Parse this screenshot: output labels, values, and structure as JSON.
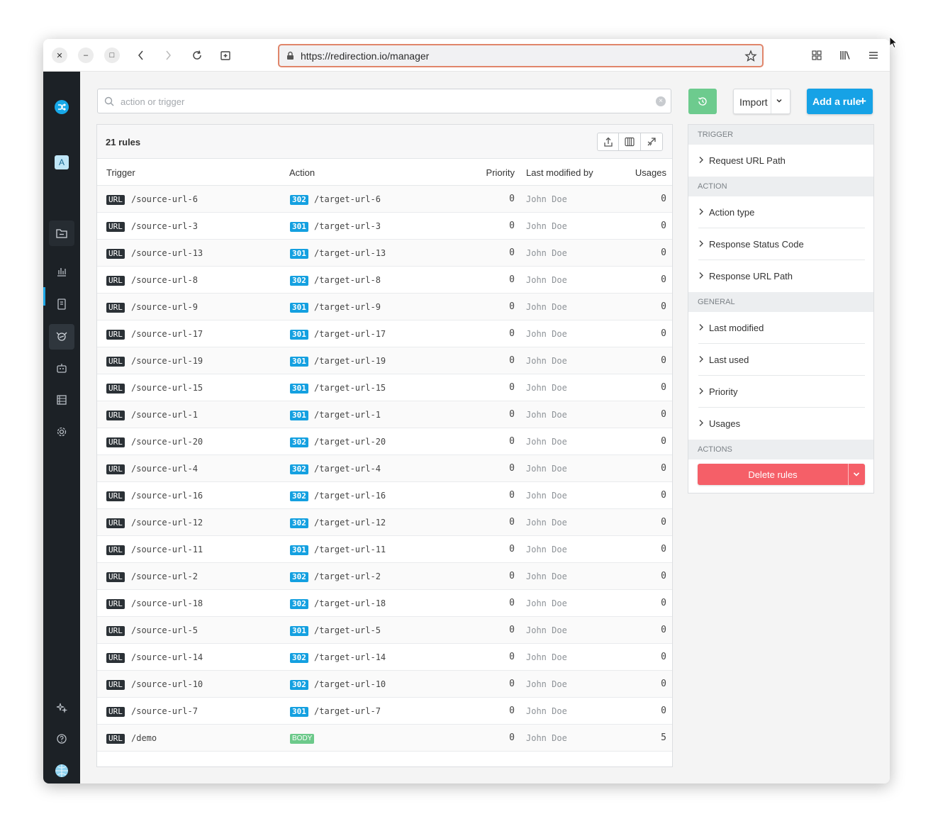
{
  "browser": {
    "url": "https://redirection.io/manager",
    "window_buttons": [
      "close",
      "minimize",
      "maximize"
    ]
  },
  "colors": {
    "accent": "#16a2e6",
    "success": "#6dcb8e",
    "danger": "#f55f68",
    "sidebar": "#1c2126"
  },
  "sidebar": {
    "avatar_letter": "A",
    "icons": [
      "redirection-logo-icon",
      "project-icon",
      "folder-icon",
      "analytics-icon",
      "logs-icon",
      "rules-icon",
      "robot-icon",
      "instances-icon",
      "settings-icon",
      "sparkles-icon",
      "help-icon",
      "globe-icon",
      "expand-icon"
    ]
  },
  "search": {
    "placeholder": "action or trigger"
  },
  "toolbar": {
    "import_label": "Import",
    "add_rule_label": "Add a rule",
    "add_rule_plus": "+"
  },
  "table": {
    "count_label": "21 rules",
    "columns": {
      "trigger": "Trigger",
      "action": "Action",
      "priority": "Priority",
      "last_modified_by": "Last modified by",
      "usages": "Usages"
    },
    "rows": [
      {
        "type": "URL",
        "source": "/source-url-6",
        "code": "302",
        "target": "/target-url-6",
        "priority": "0",
        "by": "John Doe",
        "usages": "0"
      },
      {
        "type": "URL",
        "source": "/source-url-3",
        "code": "301",
        "target": "/target-url-3",
        "priority": "0",
        "by": "John Doe",
        "usages": "0"
      },
      {
        "type": "URL",
        "source": "/source-url-13",
        "code": "301",
        "target": "/target-url-13",
        "priority": "0",
        "by": "John Doe",
        "usages": "0"
      },
      {
        "type": "URL",
        "source": "/source-url-8",
        "code": "302",
        "target": "/target-url-8",
        "priority": "0",
        "by": "John Doe",
        "usages": "0"
      },
      {
        "type": "URL",
        "source": "/source-url-9",
        "code": "301",
        "target": "/target-url-9",
        "priority": "0",
        "by": "John Doe",
        "usages": "0"
      },
      {
        "type": "URL",
        "source": "/source-url-17",
        "code": "301",
        "target": "/target-url-17",
        "priority": "0",
        "by": "John Doe",
        "usages": "0"
      },
      {
        "type": "URL",
        "source": "/source-url-19",
        "code": "301",
        "target": "/target-url-19",
        "priority": "0",
        "by": "John Doe",
        "usages": "0"
      },
      {
        "type": "URL",
        "source": "/source-url-15",
        "code": "301",
        "target": "/target-url-15",
        "priority": "0",
        "by": "John Doe",
        "usages": "0"
      },
      {
        "type": "URL",
        "source": "/source-url-1",
        "code": "301",
        "target": "/target-url-1",
        "priority": "0",
        "by": "John Doe",
        "usages": "0"
      },
      {
        "type": "URL",
        "source": "/source-url-20",
        "code": "302",
        "target": "/target-url-20",
        "priority": "0",
        "by": "John Doe",
        "usages": "0"
      },
      {
        "type": "URL",
        "source": "/source-url-4",
        "code": "302",
        "target": "/target-url-4",
        "priority": "0",
        "by": "John Doe",
        "usages": "0"
      },
      {
        "type": "URL",
        "source": "/source-url-16",
        "code": "302",
        "target": "/target-url-16",
        "priority": "0",
        "by": "John Doe",
        "usages": "0"
      },
      {
        "type": "URL",
        "source": "/source-url-12",
        "code": "302",
        "target": "/target-url-12",
        "priority": "0",
        "by": "John Doe",
        "usages": "0"
      },
      {
        "type": "URL",
        "source": "/source-url-11",
        "code": "301",
        "target": "/target-url-11",
        "priority": "0",
        "by": "John Doe",
        "usages": "0"
      },
      {
        "type": "URL",
        "source": "/source-url-2",
        "code": "302",
        "target": "/target-url-2",
        "priority": "0",
        "by": "John Doe",
        "usages": "0"
      },
      {
        "type": "URL",
        "source": "/source-url-18",
        "code": "302",
        "target": "/target-url-18",
        "priority": "0",
        "by": "John Doe",
        "usages": "0"
      },
      {
        "type": "URL",
        "source": "/source-url-5",
        "code": "301",
        "target": "/target-url-5",
        "priority": "0",
        "by": "John Doe",
        "usages": "0"
      },
      {
        "type": "URL",
        "source": "/source-url-14",
        "code": "302",
        "target": "/target-url-14",
        "priority": "0",
        "by": "John Doe",
        "usages": "0"
      },
      {
        "type": "URL",
        "source": "/source-url-10",
        "code": "302",
        "target": "/target-url-10",
        "priority": "0",
        "by": "John Doe",
        "usages": "0"
      },
      {
        "type": "URL",
        "source": "/source-url-7",
        "code": "301",
        "target": "/target-url-7",
        "priority": "0",
        "by": "John Doe",
        "usages": "0"
      },
      {
        "type": "URL",
        "source": "/demo",
        "body": "BODY",
        "priority": "0",
        "by": "John Doe",
        "usages": "5"
      }
    ]
  },
  "filters": {
    "sections": [
      {
        "title": "TRIGGER",
        "items": [
          "Request URL Path"
        ]
      },
      {
        "title": "ACTION",
        "items": [
          "Action type",
          "Response Status Code",
          "Response URL Path"
        ]
      },
      {
        "title": "GENERAL",
        "items": [
          "Last modified",
          "Last used",
          "Priority",
          "Usages"
        ]
      },
      {
        "title": "ACTIONS",
        "items": []
      }
    ],
    "delete_label": "Delete rules"
  }
}
